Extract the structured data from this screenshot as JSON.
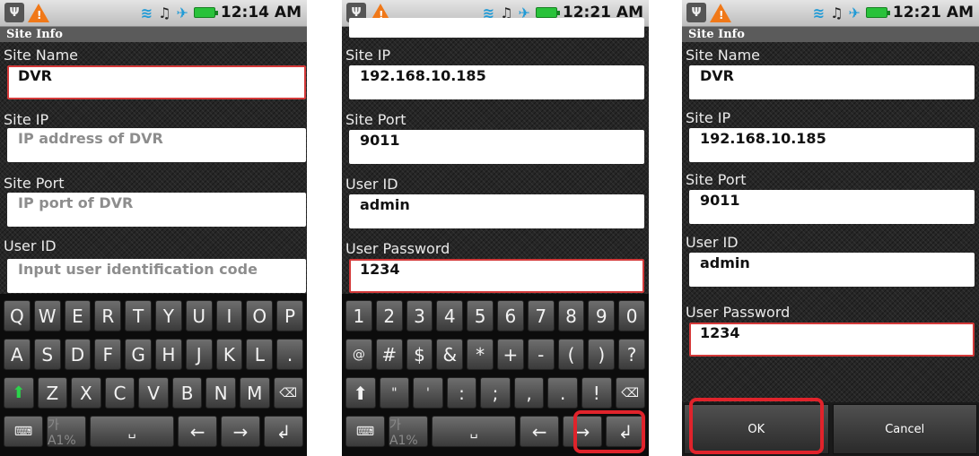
{
  "status": {
    "usb_glyph": "Ψ",
    "screen1_time": "12:14 AM",
    "screen2_time": "12:21 AM",
    "screen3_time": "12:21 AM"
  },
  "screen1": {
    "title": "Site Info",
    "labels": {
      "site_name": "Site Name",
      "site_ip": "Site IP",
      "site_port": "Site Port",
      "user_id": "User ID"
    },
    "values": {
      "site_name": "DVR"
    },
    "placeholders": {
      "site_ip": "IP address of DVR",
      "site_port": "IP port of DVR",
      "user_id": "Input user identification code"
    },
    "keyboard": {
      "row1": [
        "Q",
        "W",
        "E",
        "R",
        "T",
        "Y",
        "U",
        "I",
        "O",
        "P"
      ],
      "row2": [
        "A",
        "S",
        "D",
        "F",
        "G",
        "H",
        "J",
        "K",
        "L",
        "."
      ],
      "row3": [
        "⬆",
        "Z",
        "X",
        "C",
        "V",
        "B",
        "N",
        "M",
        "⌫"
      ],
      "row4": [
        "⌨",
        "가A1%",
        "␣",
        "←",
        "→",
        "↲"
      ]
    }
  },
  "screen2": {
    "labels": {
      "site_ip": "Site IP",
      "site_port": "Site Port",
      "user_id": "User ID",
      "user_password": "User Password"
    },
    "values": {
      "site_ip": "192.168.10.185",
      "site_port": "9011",
      "user_id": "admin",
      "user_password": "1234"
    },
    "keyboard": {
      "row1": [
        "1",
        "2",
        "3",
        "4",
        "5",
        "6",
        "7",
        "8",
        "9",
        "0"
      ],
      "row2": [
        "@",
        "#",
        "$",
        "&",
        "*",
        "+",
        "-",
        "(",
        ")",
        "?"
      ],
      "row3": [
        "⬆",
        "\"",
        "'",
        ":",
        ";",
        ",",
        ".",
        "!",
        "⌫"
      ],
      "row4": [
        "⌨",
        "가A1%",
        "␣",
        "←",
        "→",
        "↲"
      ]
    }
  },
  "screen3": {
    "title": "Site Info",
    "labels": {
      "site_name": "Site Name",
      "site_ip": "Site IP",
      "site_port": "Site Port",
      "user_id": "User ID",
      "user_password": "User Password"
    },
    "values": {
      "site_name": "DVR",
      "site_ip": "192.168.10.185",
      "site_port": "9011",
      "user_id": "admin",
      "user_password": "1234"
    },
    "buttons": {
      "ok": "OK",
      "cancel": "Cancel"
    }
  }
}
